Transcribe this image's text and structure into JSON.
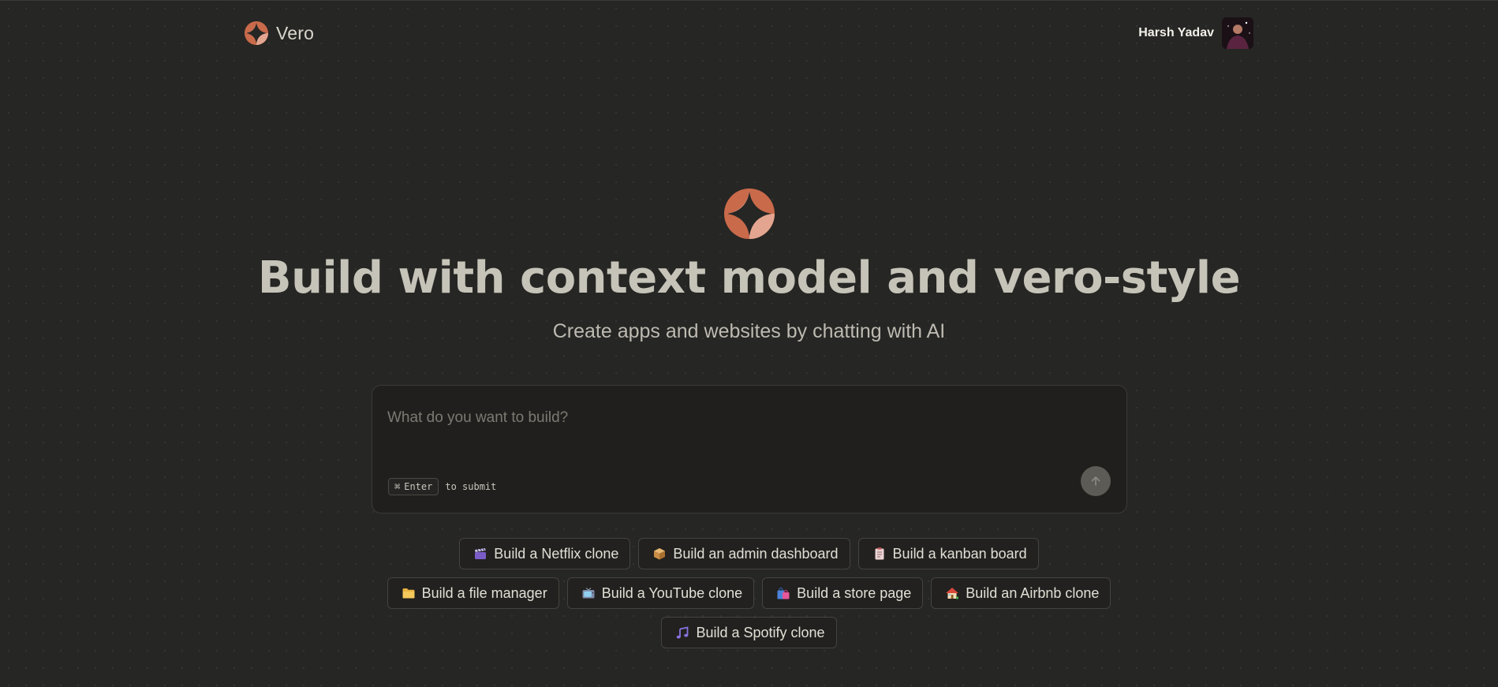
{
  "header": {
    "brand": "Vero",
    "user_name": "Harsh Yadav"
  },
  "hero": {
    "headline": "Build with context model and vero-style",
    "subtitle": "Create apps and websites by chatting with AI"
  },
  "prompt": {
    "placeholder": "What do you want to build?",
    "value": "",
    "shortcut_symbol": "⌘",
    "shortcut_key": "Enter",
    "shortcut_hint": "to submit"
  },
  "suggestions": {
    "row1": [
      {
        "label": "Build a Netflix clone",
        "icon": "clapperboard-icon"
      },
      {
        "label": "Build an admin dashboard",
        "icon": "package-icon"
      },
      {
        "label": "Build a kanban board",
        "icon": "clipboard-icon"
      }
    ],
    "row2": [
      {
        "label": "Build a file manager",
        "icon": "folder-icon"
      },
      {
        "label": "Build a YouTube clone",
        "icon": "television-icon"
      },
      {
        "label": "Build a store page",
        "icon": "shopping-bags-icon"
      },
      {
        "label": "Build an Airbnb clone",
        "icon": "house-icon"
      }
    ],
    "row3": [
      {
        "label": "Build a Spotify clone",
        "icon": "music-note-icon"
      }
    ]
  },
  "colors": {
    "background": "#262624",
    "accent": "#c96a4a",
    "accent_light": "#e4a590",
    "headline": "#c6c3b8",
    "submit_button": "#5d5b55"
  }
}
